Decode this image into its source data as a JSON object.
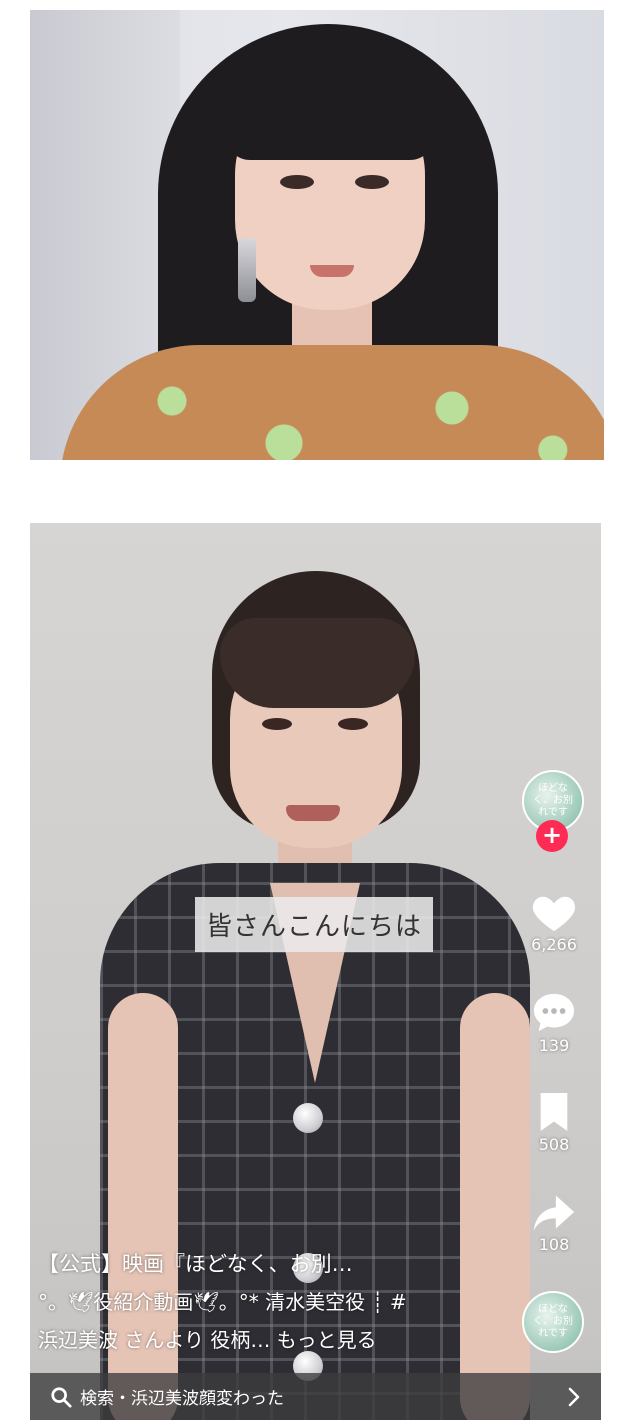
{
  "video": {
    "subtitle": "皆さんこんにちは",
    "avatar_text": "ほどなく、お別れです",
    "actions": {
      "likes": "6,266",
      "comments": "139",
      "saves": "508",
      "shares": "108"
    },
    "caption": {
      "title": "【公式】映画『ほどなく、お別…",
      "line2": "°。🕊役紹介動画🕊。°* 清水美空役 ┊ #",
      "line3": "浜辺美波 さんより 役柄… もっと見る"
    },
    "search": {
      "icon": "search-icon",
      "text": "検索・浜辺美波顔変わった",
      "chevron": "chevron-right-icon"
    },
    "accent_colors": {
      "follow": "#fe2c55",
      "text": "#ffffff"
    }
  }
}
